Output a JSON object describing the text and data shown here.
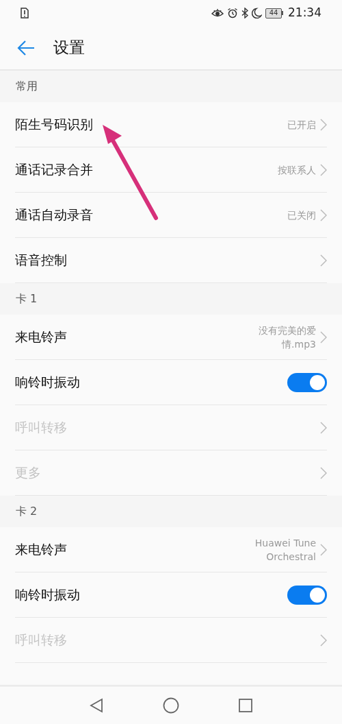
{
  "status_bar": {
    "battery": "44",
    "time": "21:34"
  },
  "header": {
    "title": "设置"
  },
  "sections": [
    {
      "title": "常用",
      "items": [
        {
          "kind": "link",
          "label": "陌生号码识别",
          "value": "已开启",
          "disabled": false
        },
        {
          "kind": "link",
          "label": "通话记录合并",
          "value": "按联系人",
          "disabled": false
        },
        {
          "kind": "link",
          "label": "通话自动录音",
          "value": "已关闭",
          "disabled": false
        },
        {
          "kind": "link",
          "label": "语音控制",
          "disabled": false
        }
      ]
    },
    {
      "title": "卡 1",
      "items": [
        {
          "kind": "link",
          "label": "来电铃声",
          "value": "没有完美的爱情.mp3",
          "disabled": false
        },
        {
          "kind": "toggle",
          "label": "响铃时振动",
          "on": true,
          "disabled": false
        },
        {
          "kind": "link",
          "label": "呼叫转移",
          "disabled": true
        },
        {
          "kind": "link",
          "label": "更多",
          "disabled": true
        }
      ]
    },
    {
      "title": "卡 2",
      "items": [
        {
          "kind": "link",
          "label": "来电铃声",
          "value": "Huawei Tune Orchestral",
          "disabled": false
        },
        {
          "kind": "toggle",
          "label": "响铃时振动",
          "on": true,
          "disabled": false
        },
        {
          "kind": "link",
          "label": "呼叫转移",
          "disabled": true
        }
      ]
    }
  ]
}
